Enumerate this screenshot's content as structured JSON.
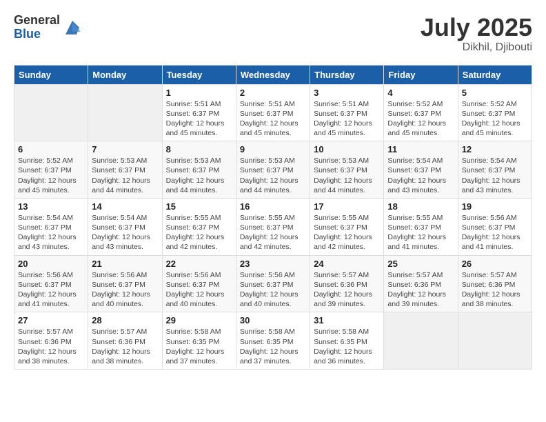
{
  "logo": {
    "general": "General",
    "blue": "Blue"
  },
  "title": {
    "month": "July 2025",
    "location": "Dikhil, Djibouti"
  },
  "weekdays": [
    "Sunday",
    "Monday",
    "Tuesday",
    "Wednesday",
    "Thursday",
    "Friday",
    "Saturday"
  ],
  "weeks": [
    [
      {
        "day": "",
        "info": ""
      },
      {
        "day": "",
        "info": ""
      },
      {
        "day": "1",
        "info": "Sunrise: 5:51 AM\nSunset: 6:37 PM\nDaylight: 12 hours and 45 minutes."
      },
      {
        "day": "2",
        "info": "Sunrise: 5:51 AM\nSunset: 6:37 PM\nDaylight: 12 hours and 45 minutes."
      },
      {
        "day": "3",
        "info": "Sunrise: 5:51 AM\nSunset: 6:37 PM\nDaylight: 12 hours and 45 minutes."
      },
      {
        "day": "4",
        "info": "Sunrise: 5:52 AM\nSunset: 6:37 PM\nDaylight: 12 hours and 45 minutes."
      },
      {
        "day": "5",
        "info": "Sunrise: 5:52 AM\nSunset: 6:37 PM\nDaylight: 12 hours and 45 minutes."
      }
    ],
    [
      {
        "day": "6",
        "info": "Sunrise: 5:52 AM\nSunset: 6:37 PM\nDaylight: 12 hours and 45 minutes."
      },
      {
        "day": "7",
        "info": "Sunrise: 5:53 AM\nSunset: 6:37 PM\nDaylight: 12 hours and 44 minutes."
      },
      {
        "day": "8",
        "info": "Sunrise: 5:53 AM\nSunset: 6:37 PM\nDaylight: 12 hours and 44 minutes."
      },
      {
        "day": "9",
        "info": "Sunrise: 5:53 AM\nSunset: 6:37 PM\nDaylight: 12 hours and 44 minutes."
      },
      {
        "day": "10",
        "info": "Sunrise: 5:53 AM\nSunset: 6:37 PM\nDaylight: 12 hours and 44 minutes."
      },
      {
        "day": "11",
        "info": "Sunrise: 5:54 AM\nSunset: 6:37 PM\nDaylight: 12 hours and 43 minutes."
      },
      {
        "day": "12",
        "info": "Sunrise: 5:54 AM\nSunset: 6:37 PM\nDaylight: 12 hours and 43 minutes."
      }
    ],
    [
      {
        "day": "13",
        "info": "Sunrise: 5:54 AM\nSunset: 6:37 PM\nDaylight: 12 hours and 43 minutes."
      },
      {
        "day": "14",
        "info": "Sunrise: 5:54 AM\nSunset: 6:37 PM\nDaylight: 12 hours and 43 minutes."
      },
      {
        "day": "15",
        "info": "Sunrise: 5:55 AM\nSunset: 6:37 PM\nDaylight: 12 hours and 42 minutes."
      },
      {
        "day": "16",
        "info": "Sunrise: 5:55 AM\nSunset: 6:37 PM\nDaylight: 12 hours and 42 minutes."
      },
      {
        "day": "17",
        "info": "Sunrise: 5:55 AM\nSunset: 6:37 PM\nDaylight: 12 hours and 42 minutes."
      },
      {
        "day": "18",
        "info": "Sunrise: 5:55 AM\nSunset: 6:37 PM\nDaylight: 12 hours and 41 minutes."
      },
      {
        "day": "19",
        "info": "Sunrise: 5:56 AM\nSunset: 6:37 PM\nDaylight: 12 hours and 41 minutes."
      }
    ],
    [
      {
        "day": "20",
        "info": "Sunrise: 5:56 AM\nSunset: 6:37 PM\nDaylight: 12 hours and 41 minutes."
      },
      {
        "day": "21",
        "info": "Sunrise: 5:56 AM\nSunset: 6:37 PM\nDaylight: 12 hours and 40 minutes."
      },
      {
        "day": "22",
        "info": "Sunrise: 5:56 AM\nSunset: 6:37 PM\nDaylight: 12 hours and 40 minutes."
      },
      {
        "day": "23",
        "info": "Sunrise: 5:56 AM\nSunset: 6:37 PM\nDaylight: 12 hours and 40 minutes."
      },
      {
        "day": "24",
        "info": "Sunrise: 5:57 AM\nSunset: 6:36 PM\nDaylight: 12 hours and 39 minutes."
      },
      {
        "day": "25",
        "info": "Sunrise: 5:57 AM\nSunset: 6:36 PM\nDaylight: 12 hours and 39 minutes."
      },
      {
        "day": "26",
        "info": "Sunrise: 5:57 AM\nSunset: 6:36 PM\nDaylight: 12 hours and 38 minutes."
      }
    ],
    [
      {
        "day": "27",
        "info": "Sunrise: 5:57 AM\nSunset: 6:36 PM\nDaylight: 12 hours and 38 minutes."
      },
      {
        "day": "28",
        "info": "Sunrise: 5:57 AM\nSunset: 6:36 PM\nDaylight: 12 hours and 38 minutes."
      },
      {
        "day": "29",
        "info": "Sunrise: 5:58 AM\nSunset: 6:35 PM\nDaylight: 12 hours and 37 minutes."
      },
      {
        "day": "30",
        "info": "Sunrise: 5:58 AM\nSunset: 6:35 PM\nDaylight: 12 hours and 37 minutes."
      },
      {
        "day": "31",
        "info": "Sunrise: 5:58 AM\nSunset: 6:35 PM\nDaylight: 12 hours and 36 minutes."
      },
      {
        "day": "",
        "info": ""
      },
      {
        "day": "",
        "info": ""
      }
    ]
  ]
}
